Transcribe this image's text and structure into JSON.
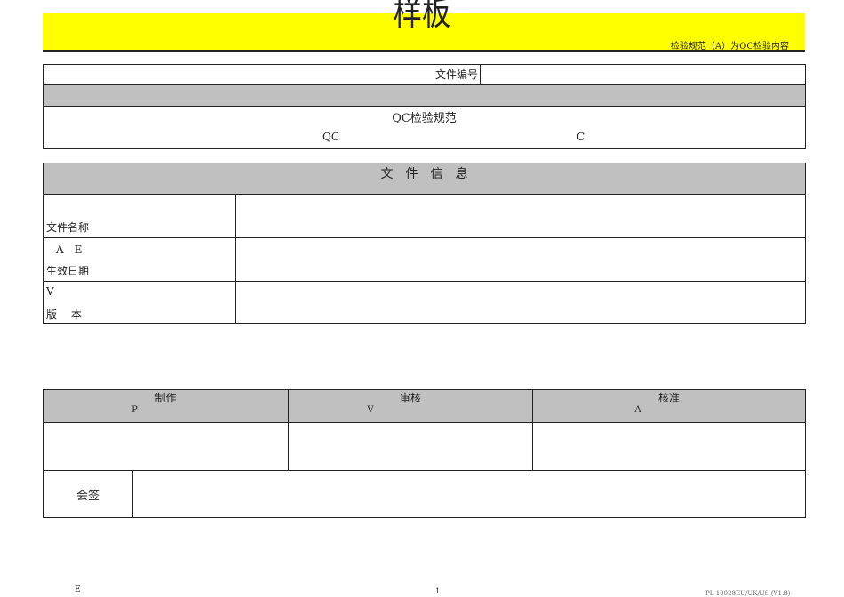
{
  "header": {
    "title": "样板",
    "note": "检验规范（A）为QC检验内容",
    "colors": {
      "banner": "#ffff00",
      "gray": "#c0c0c0"
    }
  },
  "doc": {
    "number_label": "文件编号",
    "number_value": "",
    "spec_title": "QC检验规范",
    "sub_left": "QC",
    "sub_right": "C"
  },
  "info": {
    "heading": "文　件　信　息",
    "rows": [
      {
        "marker": "",
        "label": "文件名称",
        "value": ""
      },
      {
        "marker": "A　E",
        "label": "生效日期",
        "value": ""
      },
      {
        "marker": "V",
        "label": "版　 本",
        "value": ""
      }
    ]
  },
  "approval": {
    "cols": [
      {
        "label": "制作",
        "code": "P"
      },
      {
        "label": "审核",
        "code": "V"
      },
      {
        "label": "核准",
        "code": "A"
      }
    ],
    "countersign": "会签"
  },
  "footer": {
    "left": "E",
    "mid": "1",
    "code": "PL-10028EU/UK/US (V1.8)"
  }
}
